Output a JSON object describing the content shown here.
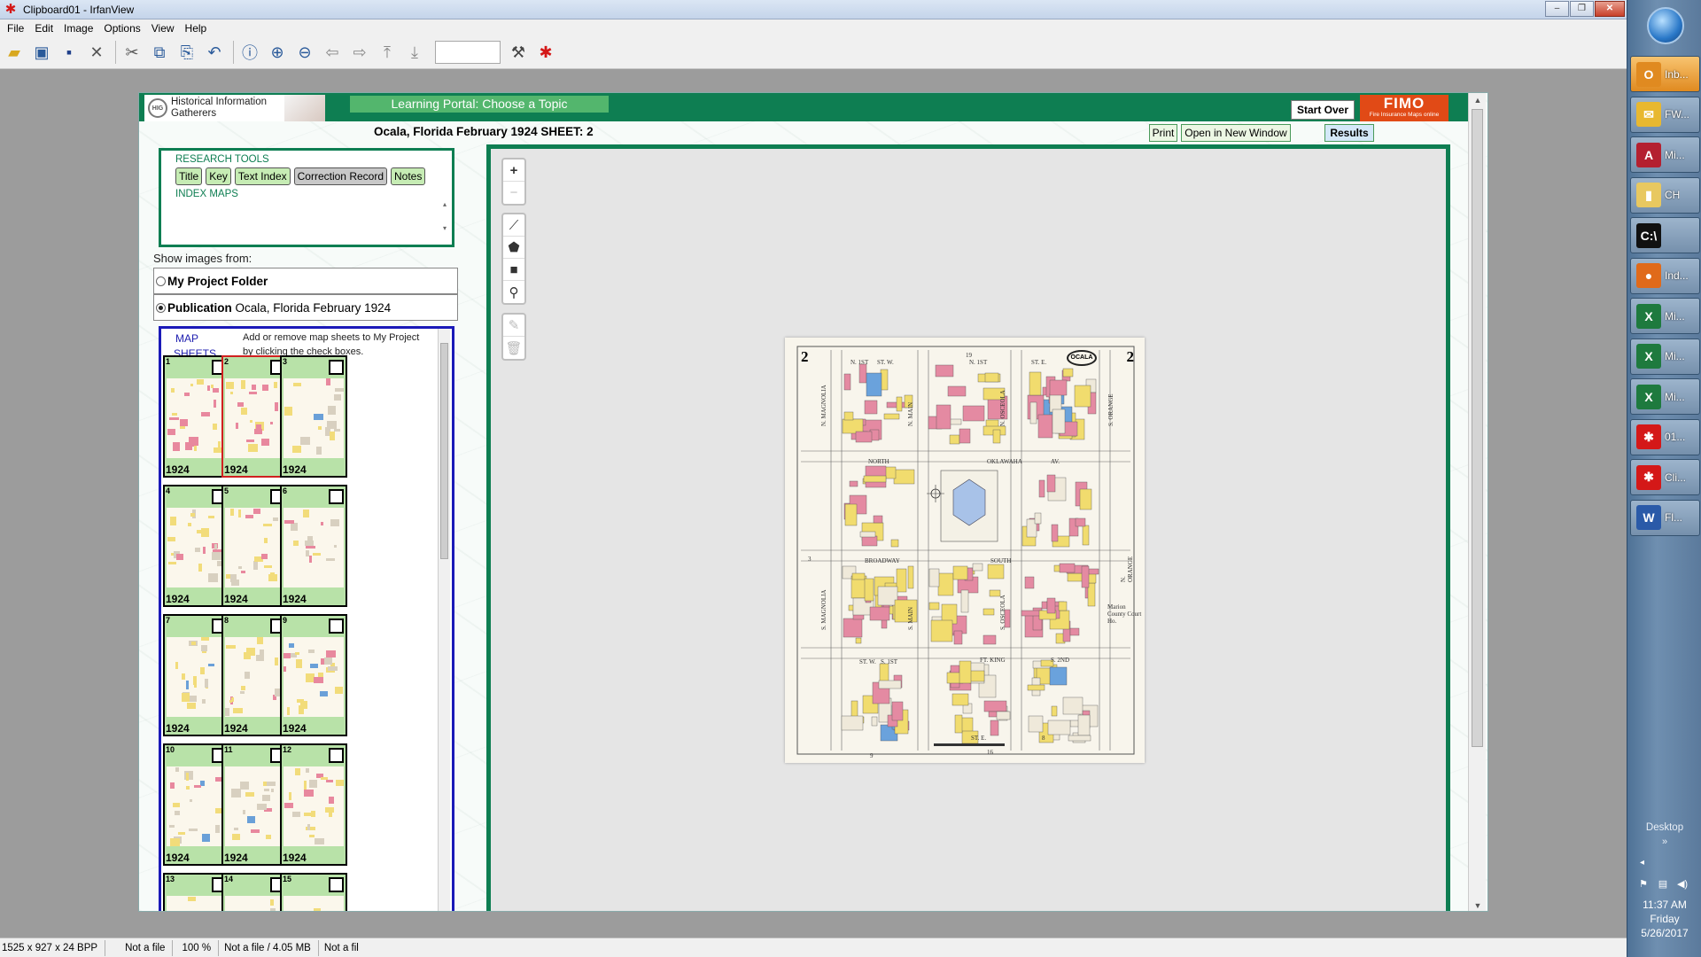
{
  "window": {
    "title": "Clipboard01 - IrfanView",
    "controls": {
      "minimize": "–",
      "maximize": "❐",
      "close": "✕"
    }
  },
  "menu": [
    "File",
    "Edit",
    "Image",
    "Options",
    "View",
    "Help"
  ],
  "toolbar": {
    "icons": [
      "open-folder-icon",
      "slideshow-icon",
      "save-icon",
      "delete-icon",
      "cut-icon",
      "copy-icon",
      "paste-icon",
      "undo-icon",
      "info-icon",
      "zoom-in-icon",
      "zoom-out-icon",
      "previous-icon",
      "next-icon",
      "first-page-icon",
      "last-page-icon",
      "settings-icon",
      "paint-icon"
    ],
    "page_input_value": ""
  },
  "status": {
    "dimensions": "1525 x 927 x 24 BPP",
    "file": "Not a file",
    "zoom": "100 %",
    "size": "Not a file / 4.05 MB",
    "extra": "Not a fil"
  },
  "site": {
    "logo_line1": "Historical Information",
    "logo_line2": "Gatherers",
    "logo_badge": "HIG",
    "portal_banner": "Learning Portal: Choose a Topic",
    "start_over": "Start Over",
    "fimo_title": "FIMO",
    "fimo_subtitle": "Fire Insurance Maps online",
    "sheet_title": "Ocala, Florida February 1924 SHEET: 2",
    "print": "Print",
    "open_new_window": "Open in New Window",
    "results": "Results"
  },
  "research": {
    "heading": "RESEARCH TOOLS",
    "buttons": [
      "Title",
      "Key",
      "Text Index",
      "Correction Record",
      "Notes"
    ],
    "index_heading": "INDEX MAPS"
  },
  "show_images": {
    "label": "Show images from:",
    "project_folder": "My Project Folder",
    "publication_label": "Publication",
    "publication_value": "Ocala, Florida February 1924",
    "selected": "publication"
  },
  "map_sheets": {
    "heading_line1": "MAP",
    "heading_line2": "SHEETS",
    "note_line1": "Add or remove map sheets to My Project",
    "note_line2": "by clicking the check boxes.",
    "sheets": [
      {
        "num": "1",
        "year": "1924"
      },
      {
        "num": "2",
        "year": "1924"
      },
      {
        "num": "3",
        "year": "1924"
      },
      {
        "num": "4",
        "year": "1924"
      },
      {
        "num": "5",
        "year": "1924"
      },
      {
        "num": "6",
        "year": "1924"
      },
      {
        "num": "7",
        "year": "1924"
      },
      {
        "num": "8",
        "year": "1924"
      },
      {
        "num": "9",
        "year": "1924"
      },
      {
        "num": "10",
        "year": "1924"
      },
      {
        "num": "11",
        "year": "1924"
      },
      {
        "num": "12",
        "year": "1924"
      },
      {
        "num": "13",
        "year": ""
      },
      {
        "num": "14",
        "year": ""
      },
      {
        "num": "15",
        "year": ""
      }
    ],
    "selected_sheet": "2"
  },
  "viewer_tools": {
    "zoom_in": "+",
    "zoom_out": "−",
    "draw_tools": [
      "draw-line-icon",
      "draw-polygon-icon",
      "draw-rectangle-icon",
      "draw-marker-icon"
    ],
    "edit_tools": [
      "edit-layers-icon",
      "delete-layers-icon"
    ]
  },
  "map": {
    "sheet_number": "2",
    "badge": "OCALA",
    "street_labels": [
      "19",
      "N. 1ST",
      "ST. W.",
      "N. 1ST",
      "ST. E.",
      "NORTH",
      "OKLAWAHA",
      "AV.",
      "BROADWAY",
      "SOUTH",
      "FT. KING",
      "S. 2ND",
      "ST. W.",
      "S. 1ST",
      "ST. E.",
      "8",
      "9",
      "16",
      "3",
      "N. ORANGE",
      "N. MAGNOLIA",
      "N. MAIN",
      "N. OSCEOLA",
      "S. ORANGE",
      "S. MAGNOLIA",
      "S. MAIN",
      "S. OSCEOLA",
      "Marion County Court Ho."
    ]
  },
  "taskbar": {
    "items": [
      {
        "label": "Inb...",
        "icon": "outlook-icon",
        "color": "#e08a20",
        "glyph": "O"
      },
      {
        "label": "FW...",
        "icon": "envelope-icon",
        "color": "#e8b830",
        "glyph": "✉"
      },
      {
        "label": "Mi...",
        "icon": "access-icon",
        "color": "#b42030",
        "glyph": "A"
      },
      {
        "label": "CH",
        "icon": "folder-icon",
        "color": "#e8c860",
        "glyph": "▮"
      },
      {
        "label": "",
        "icon": "command-prompt-icon",
        "color": "#111111",
        "glyph": "C:\\"
      },
      {
        "label": "Ind...",
        "icon": "firefox-icon",
        "color": "#e06a1a",
        "glyph": "●"
      },
      {
        "label": "Mi...",
        "icon": "excel-icon",
        "color": "#1e7a3e",
        "glyph": "X"
      },
      {
        "label": "Mi...",
        "icon": "excel-icon",
        "color": "#1e7a3e",
        "glyph": "X"
      },
      {
        "label": "Mi...",
        "icon": "excel-icon",
        "color": "#1e7a3e",
        "glyph": "X"
      },
      {
        "label": "01...",
        "icon": "irfanview-icon",
        "color": "#d41818",
        "glyph": "✱"
      },
      {
        "label": "Cli...",
        "icon": "irfanview-icon",
        "color": "#d41818",
        "glyph": "✱"
      },
      {
        "label": "Fl...",
        "icon": "word-icon",
        "color": "#2a5aa8",
        "glyph": "W"
      }
    ],
    "active_index": 0,
    "desktop": "Desktop",
    "desktop_chevron": "»",
    "tray_arrow": "◂",
    "time": "11:37 AM",
    "day": "Friday",
    "date": "5/26/2017"
  }
}
